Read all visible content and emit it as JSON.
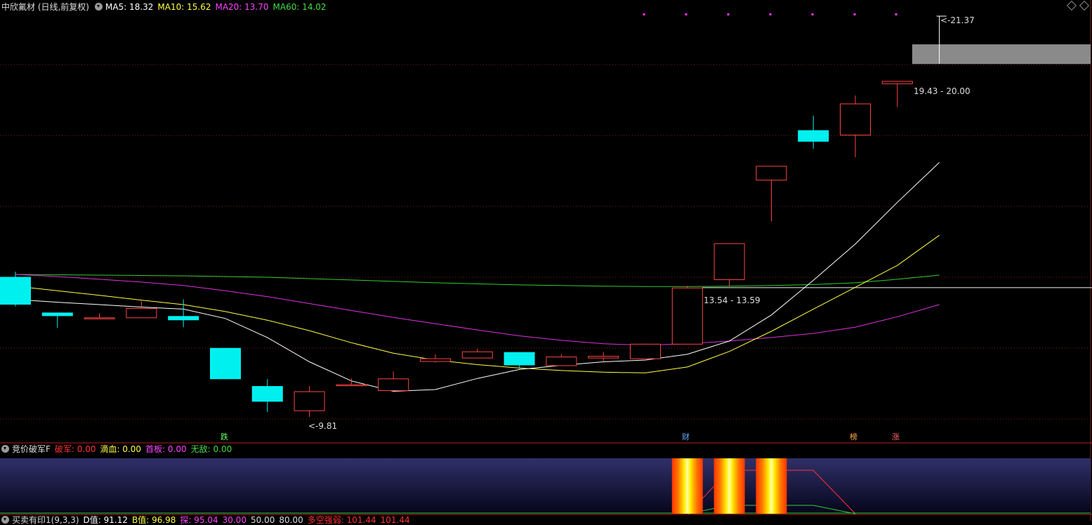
{
  "header": {
    "title": "中欣氟材 (日线,前复权)",
    "ma5": "MA5: 18.32",
    "ma10": "MA10: 15.62",
    "ma20": "MA20: 13.70",
    "ma60": "MA60: 14.02",
    "colors": {
      "ma5": "#ffffff",
      "ma10": "#ffff44",
      "ma20": "#ff44ff",
      "ma60": "#44dd44"
    }
  },
  "labels": {
    "high": "21.37",
    "low": "9.81",
    "zone_upper": "19.43 - 20.00",
    "zone_lower": "13.54 - 13.59"
  },
  "signals": [
    {
      "text": "跌",
      "color": "#66ff66"
    },
    {
      "text": "财",
      "color": "#66aaff"
    },
    {
      "text": "榜",
      "color": "#ffaa44"
    },
    {
      "text": "涨",
      "color": "#ff6666"
    }
  ],
  "sub": {
    "title": "竞价破军F",
    "pojun": "破军: 0.00",
    "dixue": "滴血: 0.00",
    "shouban": "首板: 0.00",
    "wudi": "无敌: 0.00",
    "colors": {
      "pojun": "#ff3333",
      "dixue": "#ffff44",
      "shouban": "#ff44ff",
      "wudi": "#44dd44"
    }
  },
  "bottom": {
    "title": "买卖有印1(9,3,3)",
    "d": "D值: 91.12",
    "b": "B值: 96.98",
    "bottom": "探: 95.04",
    "v30": "30.00",
    "v50": "50.00",
    "v80": "80.00",
    "dir": "多空强弱: 101.44",
    "val": "101.44"
  },
  "chart_data": {
    "type": "candlestick",
    "up_color": "#ff4444",
    "down_color": "#00f0f0",
    "candles": [
      {
        "o": 13.85,
        "c": 13.05,
        "h": 14.0,
        "l": 13.0
      },
      {
        "o": 12.82,
        "c": 12.72,
        "h": 12.82,
        "l": 12.38
      },
      {
        "o": 12.68,
        "c": 12.68,
        "h": 12.8,
        "l": 12.68
      },
      {
        "o": 12.68,
        "c": 12.95,
        "h": 13.15,
        "l": 12.68
      },
      {
        "o": 12.72,
        "c": 12.6,
        "h": 13.2,
        "l": 12.4
      },
      {
        "o": 11.8,
        "c": 10.9,
        "h": 11.8,
        "l": 10.9
      },
      {
        "o": 10.7,
        "c": 10.25,
        "h": 10.9,
        "l": 9.95
      },
      {
        "o": 10.0,
        "c": 10.55,
        "h": 10.7,
        "l": 9.81
      },
      {
        "o": 10.75,
        "c": 10.75,
        "h": 10.92,
        "l": 10.73
      },
      {
        "o": 10.58,
        "c": 10.92,
        "h": 11.12,
        "l": 10.58
      },
      {
        "o": 11.42,
        "c": 11.5,
        "h": 11.62,
        "l": 11.38
      },
      {
        "o": 11.52,
        "c": 11.7,
        "h": 11.78,
        "l": 11.52
      },
      {
        "o": 11.68,
        "c": 11.3,
        "h": 11.68,
        "l": 11.2
      },
      {
        "o": 11.3,
        "c": 11.55,
        "h": 11.62,
        "l": 11.3
      },
      {
        "o": 11.52,
        "c": 11.57,
        "h": 11.68,
        "l": 11.4
      },
      {
        "o": 11.5,
        "c": 11.92,
        "h": 11.92,
        "l": 11.5
      },
      {
        "o": 11.92,
        "c": 13.54,
        "h": 13.59,
        "l": 11.92
      },
      {
        "o": 13.78,
        "c": 14.82,
        "h": 14.82,
        "l": 13.59
      },
      {
        "o": 16.65,
        "c": 17.05,
        "h": 17.05,
        "l": 15.45
      },
      {
        "o": 18.08,
        "c": 17.75,
        "h": 18.5,
        "l": 17.55
      },
      {
        "o": 17.95,
        "c": 18.85,
        "h": 19.08,
        "l": 17.3
      },
      {
        "o": 19.43,
        "c": 19.5,
        "h": 19.5,
        "l": 18.75
      },
      {
        "o": 21.37,
        "c": 21.37,
        "h": 21.37,
        "l": 20.0
      }
    ],
    "ma5": [
      13.2,
      13.12,
      13.05,
      12.98,
      12.92,
      12.65,
      12.1,
      11.4,
      10.85,
      10.55,
      10.6,
      10.92,
      11.18,
      11.3,
      11.4,
      11.45,
      11.62,
      12.0,
      12.75,
      13.75,
      14.8,
      16.0,
      17.15
    ],
    "ma10": [
      13.58,
      13.45,
      13.32,
      13.18,
      13.05,
      12.85,
      12.6,
      12.3,
      11.95,
      11.65,
      11.45,
      11.32,
      11.22,
      11.15,
      11.1,
      11.08,
      11.25,
      11.7,
      12.28,
      12.92,
      13.55,
      14.18,
      15.05
    ],
    "ma20": [
      13.92,
      13.86,
      13.78,
      13.7,
      13.6,
      13.45,
      13.28,
      13.08,
      12.88,
      12.68,
      12.5,
      12.32,
      12.15,
      12.02,
      11.92,
      11.88,
      11.92,
      12.0,
      12.1,
      12.22,
      12.4,
      12.7,
      13.05
    ],
    "ma60": [
      13.92,
      13.91,
      13.9,
      13.89,
      13.88,
      13.86,
      13.84,
      13.8,
      13.76,
      13.72,
      13.68,
      13.65,
      13.62,
      13.6,
      13.58,
      13.57,
      13.57,
      13.58,
      13.6,
      13.63,
      13.68,
      13.78,
      13.9
    ],
    "zone_upper": [
      19.43,
      20.0
    ],
    "zone_lower": [
      13.54,
      13.59
    ],
    "sub_bars": [
      16,
      17,
      18
    ]
  }
}
